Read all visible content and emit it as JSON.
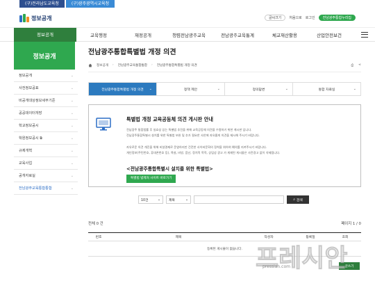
{
  "top_tabs": [
    "(구)전라남도교육청",
    "(구)광주광역시교육청"
  ],
  "header": {
    "logo_text": "정보공개",
    "buttons": [
      "글씨크기",
      "처음으로",
      "로그인",
      "전남광주통합누리집"
    ],
    "font_size_label": "글씨크기",
    "home_label": "처음으로",
    "login_label": "로그인",
    "portal_label": "전남광주통합누리집"
  },
  "gnb": {
    "items": [
      "정보공개",
      "교육행정",
      "재정공개",
      "청렴전남광주교육",
      "전남광주교육통계",
      "체교재산활용",
      "산업안전보건"
    ],
    "active_index": 0,
    "mark_colors": {
      "blue": "#2c6ec6",
      "green": "#2fa84f",
      "orange": "#f28c28"
    }
  },
  "sidebar": {
    "title": "정보공개",
    "items": [
      {
        "label": "정보공개",
        "ext": false
      },
      {
        "label": "사전정보공표",
        "ext": false
      },
      {
        "label": "비공개대상정보세부기준",
        "ext": false
      },
      {
        "label": "공공데이터개방",
        "ext": false
      },
      {
        "label": "학교정보공시",
        "ext": false
      },
      {
        "label": "학원정보공시",
        "ext": true
      },
      {
        "label": "규제개혁",
        "ext": false
      },
      {
        "label": "교육사업",
        "ext": false
      },
      {
        "label": "공개자료실",
        "ext": false
      },
      {
        "label": "전남광주교육통합통합",
        "ext": false
      }
    ]
  },
  "main": {
    "page_title": "전남광주통합특별법 개정 의견",
    "breadcrumb": [
      "정보공개",
      "전남광주교육통합통합",
      "전남광주통합특별법 개정 의견"
    ],
    "tools": [
      "⎙",
      "⋖"
    ],
    "tabs": [
      {
        "label": "전남광주통합특별법 개정 의견",
        "active": true
      },
      {
        "label": "정책 제안",
        "active": false
      },
      {
        "label": "정의답변",
        "active": false
      },
      {
        "label": "통합 자료실",
        "active": false
      }
    ],
    "notice": {
      "title": "특별법 개정 교육공동체 의견 게시판 안내",
      "p1": "전남광주 통합법률 후 실효성 있는 특별법 추진을 위해 교육공동체 의견을 수렴하기 위한 게시판 입니다.",
      "p2": "전남광주통합특별시 설치를 위한 특별법 보완 및 추가 필요한 사안에 자유롭게 의견을 제시해 주시기 바랍니다.",
      "p3": "자유로운 의견 개진을 위해 비실명제로 운영하지만 건전한 사이버문화의 정착을 위하여 예의를 지켜주시기 바랍니다.",
      "p4": "개인정보(주민번호, 휴대폰번호 등), 욕설, 비방, 음난, 정치적 목적, 상업성 광고 가 게재된 게시물은 사전경고 없이 삭제됩니다.",
      "big_title": "<전남광주통합특별시 설치를 위한 특별법>",
      "link_button": "특별법 법제처 사이트 바로가기"
    },
    "search": {
      "count_option": "10건",
      "field_option": "제목",
      "placeholder": "",
      "button": "검색"
    },
    "list": {
      "total_label": "전체 0 건",
      "page_label": "페이지 1 / 0",
      "columns": [
        "번호",
        "제목",
        "작성자",
        "등록일",
        "조회"
      ],
      "empty_message": "등록된 게시물이 없습니다.",
      "write_button": "글쓰기"
    }
  },
  "watermark": {
    "text": "프레시안",
    "url": "pressian.com"
  }
}
